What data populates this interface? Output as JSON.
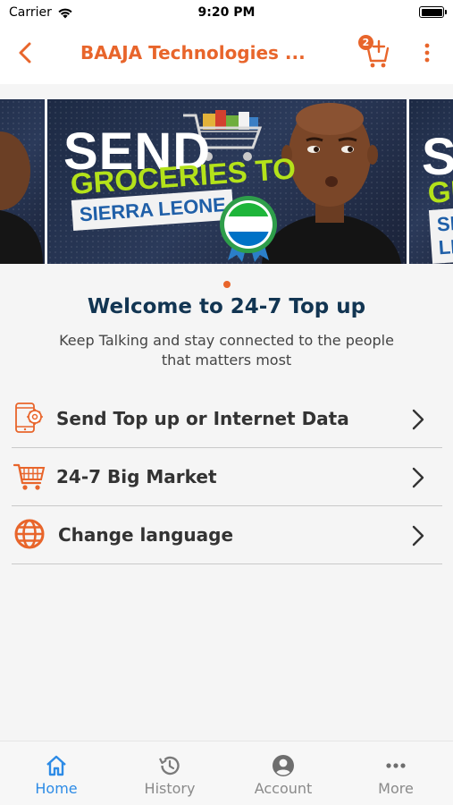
{
  "status_bar": {
    "carrier": "Carrier",
    "time": "9:20 PM"
  },
  "app_bar": {
    "title": "BAAJA Technologies ...",
    "cart_badge": "2",
    "accent_color": "#e8652b"
  },
  "banner": {
    "line1": "SEND",
    "line2": "GROCERIES TO",
    "line3": "SIERRA LEONE",
    "active_slide": 1,
    "slide_count": 1
  },
  "welcome": {
    "title": "Welcome to 24-7 Top up",
    "subtitle": "Keep Talking and stay connected to the people that matters most"
  },
  "menu": {
    "items": [
      {
        "label": "Send Top up or Internet Data",
        "icon": "phone-topup-icon"
      },
      {
        "label": "24-7 Big Market",
        "icon": "shopping-cart-icon"
      },
      {
        "label": "Change language",
        "icon": "globe-icon"
      }
    ]
  },
  "tab_bar": {
    "active_color": "#2d8be6",
    "tabs": [
      {
        "label": "Home",
        "icon": "home-icon",
        "active": true
      },
      {
        "label": "History",
        "icon": "history-icon",
        "active": false
      },
      {
        "label": "Account",
        "icon": "account-icon",
        "active": false
      },
      {
        "label": "More",
        "icon": "more-dots-icon",
        "active": false
      }
    ]
  }
}
